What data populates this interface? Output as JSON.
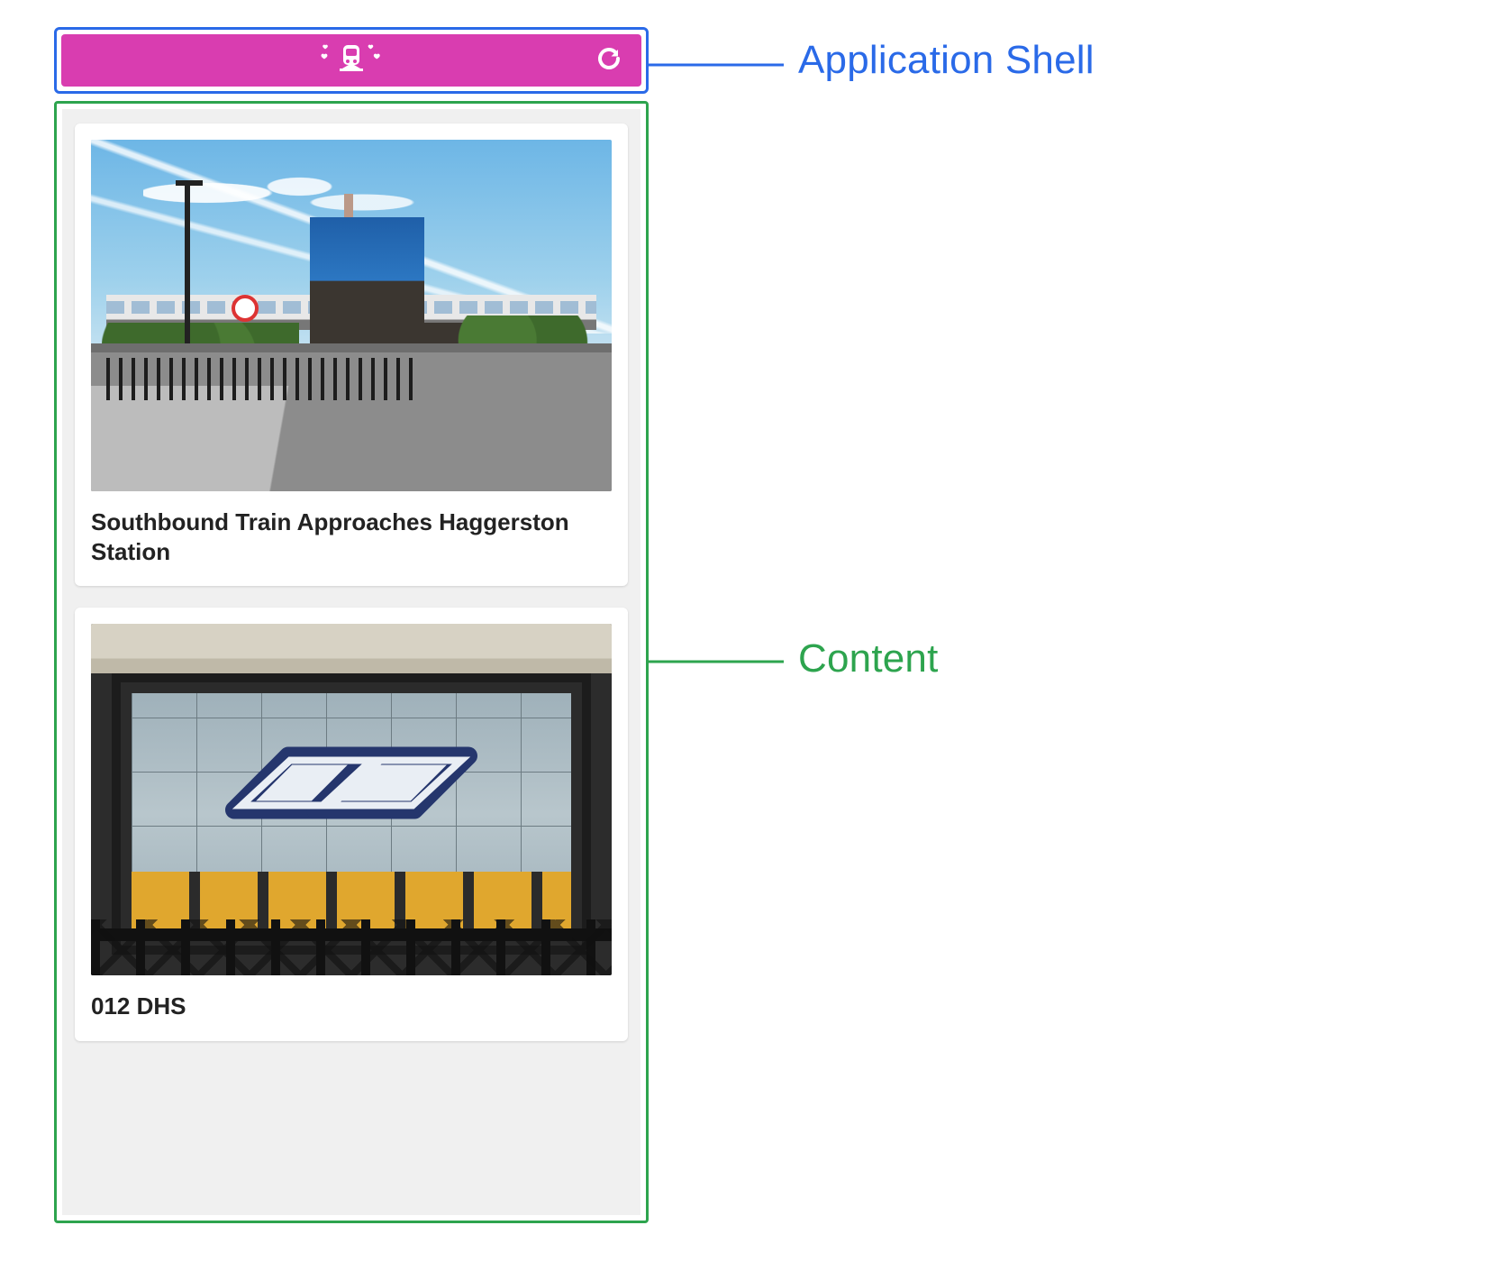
{
  "annotations": {
    "shell_label": "Application Shell",
    "content_label": "Content"
  },
  "colors": {
    "shell_outline": "#2a6ae8",
    "content_outline": "#2da44e",
    "app_bar_bg": "#d93db0"
  },
  "app_bar": {
    "logo_icon": "train-hearts-icon",
    "refresh_icon": "refresh-icon"
  },
  "cards": [
    {
      "title": "Southbound Train Approaches Haggerston Station"
    },
    {
      "title": "012 DHS"
    }
  ]
}
